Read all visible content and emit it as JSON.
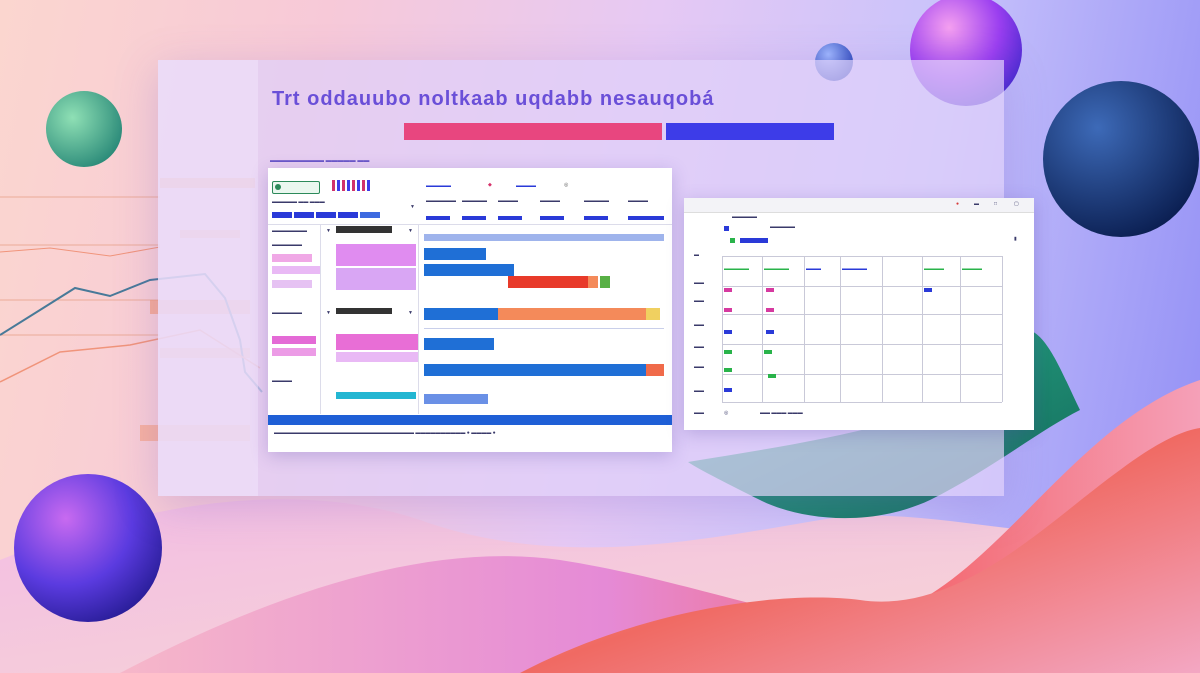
{
  "page": {
    "title": "Trt oddauubo noltkaab uqdabb nesauqobá",
    "breadcrumb": "▬▬▬▬▬▬▬▬▬ ▬▬▬▬▬ ▬▬"
  },
  "colors": {
    "accent_pink": "#e8467f",
    "accent_blue": "#3d3ce8",
    "bar_blue": "#1f6fd6",
    "bar_orange": "#f48a5a",
    "bar_red": "#e83a2a",
    "tag_green": "#29b34a",
    "tag_magenta": "#d63aa0",
    "tag_blue": "#2a3ad8"
  },
  "dashboard": {
    "header_menu": [
      "▬▬▬▬▬",
      "◆",
      "▬▬▬▬"
    ],
    "toolbar_left": "▬▬▬▬▬ ▬▬ ▬▬▬",
    "columns": [
      "▬▬▬▬▬▬",
      "▬▬▬▬▬",
      "▬▬▬▬",
      "▬▬▬▬",
      "▬▬▬▬▬",
      "▬▬▬▬"
    ],
    "sidebar_rows": [
      {
        "label": "▬▬▬▬▬▬▬",
        "expander": "▼"
      },
      {
        "label": "▬▬▬▬▬▬",
        "expander": "▼"
      },
      {
        "label": "▬▬▬▬",
        "expander": "▼"
      }
    ],
    "footer_text": "▬▬▬▬▬▬▬▬▬▬▬▬▬▬▬▬▬▬▬▬▬▬▬▬▬▬▬▬ ▬▬▬▬▬▬▬▬▬▬ ● ▬▬▬▬ ●"
  },
  "table": {
    "toolbar_label": "▬▬▬▬▬",
    "columns": [
      "▬▬▬▬▬",
      "▬▬▬▬▬",
      "▬▬▬",
      "▬▬▬▬▬",
      "▬▬▬▬",
      "▬▬▬▬"
    ],
    "rows": [
      "▬▬",
      "▬▬",
      "▬▬",
      "▬▬",
      "▬▬",
      "▬▬"
    ],
    "footer": "▬▬ ▬▬▬ ▬▬▬"
  }
}
